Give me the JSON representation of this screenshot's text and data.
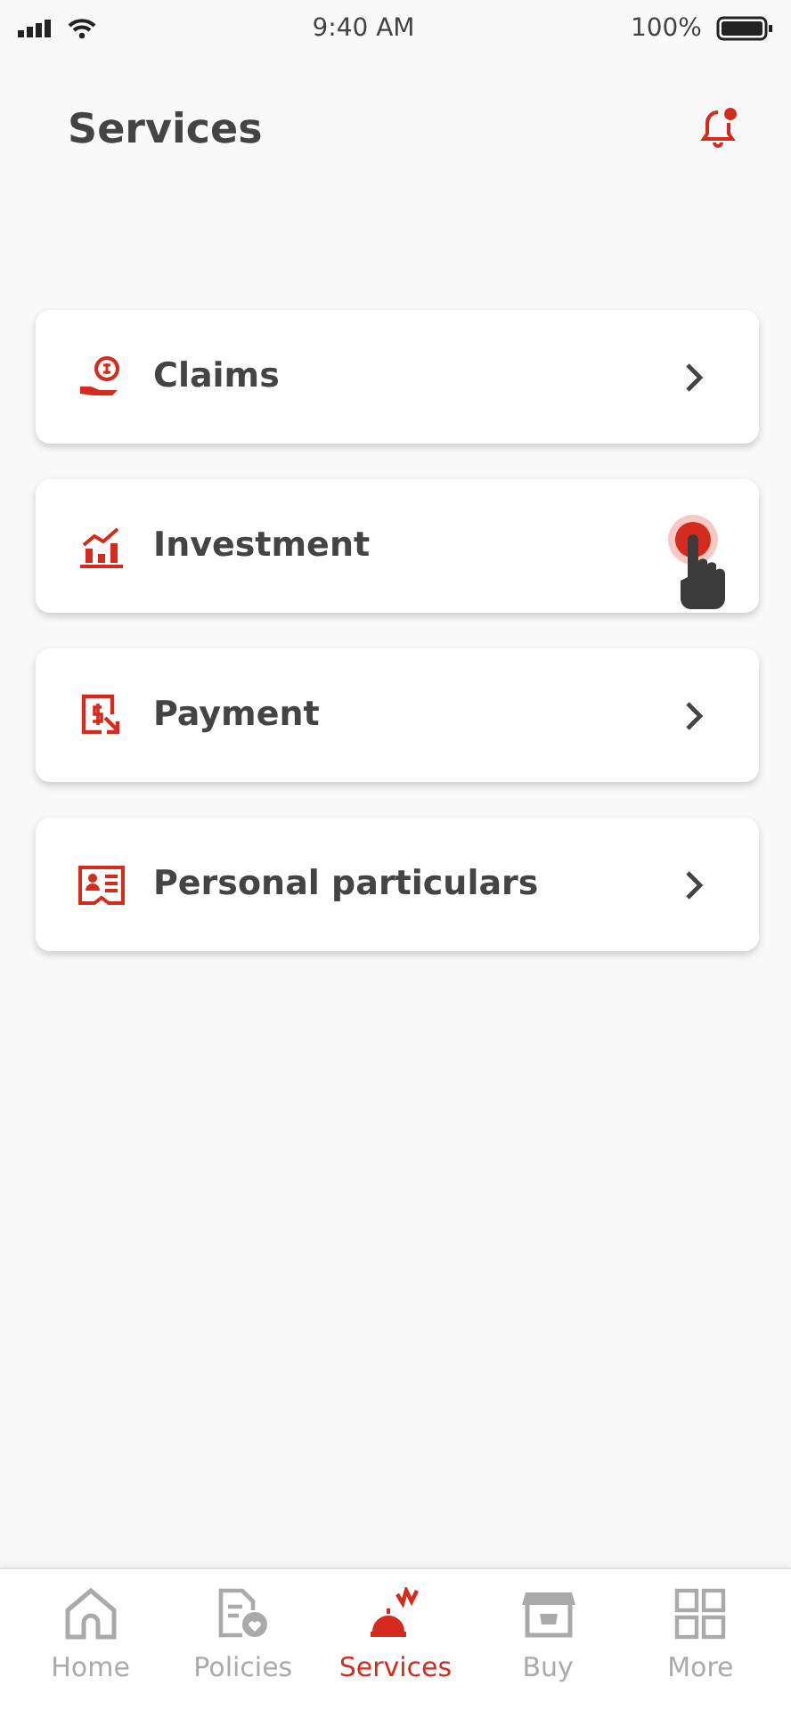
{
  "status_bar": {
    "time": "9:40 AM",
    "battery": "100%"
  },
  "header": {
    "title": "Services",
    "notification": true
  },
  "services": [
    {
      "label": "Claims",
      "touched": false
    },
    {
      "label": "Investment",
      "touched": true
    },
    {
      "label": "Payment",
      "touched": false
    },
    {
      "label": "Personal particulars",
      "touched": false
    }
  ],
  "bottom_nav": [
    {
      "label": "Home",
      "selected": false
    },
    {
      "label": "Policies",
      "selected": false
    },
    {
      "label": "Services",
      "selected": true
    },
    {
      "label": "Buy",
      "selected": false
    },
    {
      "label": "More",
      "selected": false
    }
  ]
}
